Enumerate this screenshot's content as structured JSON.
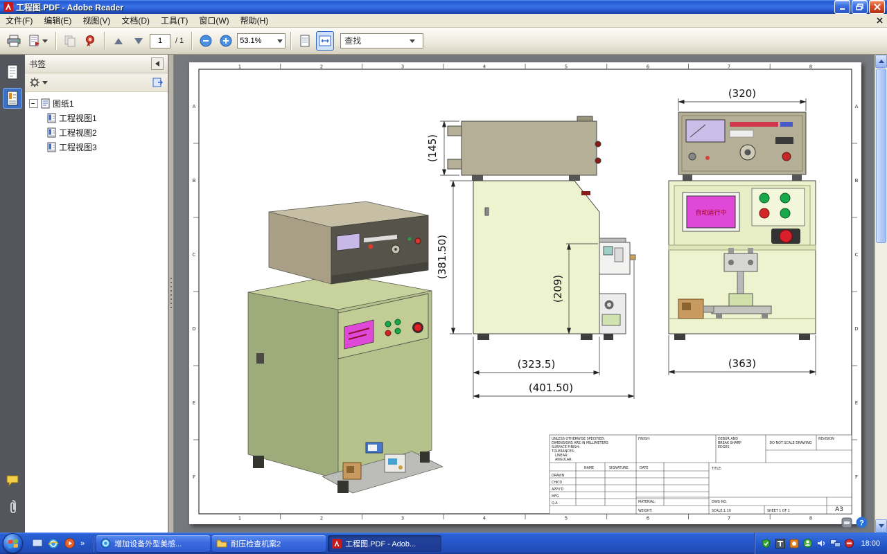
{
  "window": {
    "title": "工程图.PDF - Adobe Reader"
  },
  "menu": {
    "items": [
      "文件(F)",
      "编辑(E)",
      "视图(V)",
      "文档(D)",
      "工具(T)",
      "窗口(W)",
      "帮助(H)"
    ]
  },
  "toolbar": {
    "page_current": "1",
    "page_total": "/ 1",
    "zoom_value": "53.1%",
    "find_placeholder": "查找"
  },
  "sidebar": {
    "header": "书签",
    "tree": {
      "root": "图纸1",
      "children": [
        "工程视图1",
        "工程视图2",
        "工程视图3"
      ]
    }
  },
  "drawing": {
    "zones": {
      "cols": [
        "1",
        "2",
        "3",
        "4",
        "5",
        "6",
        "7",
        "8"
      ],
      "rows": [
        "A",
        "B",
        "C",
        "D",
        "E",
        "F"
      ]
    },
    "dims": {
      "d145": "(145)",
      "d381": "(381.50)",
      "d209": "(209)",
      "d323": "(323.5)",
      "d401": "(401.50)",
      "d320": "(320)",
      "d363": "(363)"
    },
    "screen_text": "自动运行中",
    "title_block": {
      "note1": "UNLESS OTHERWISE SPECIFIED:",
      "note2": "DIMENSIONS ARE IN MILLIMETERS",
      "note3": "SURFACE FINISH:",
      "note4": "TOLERANCES:",
      "note5": "LINEAR:",
      "note6": "ANGULAR:",
      "finish": "FINISH:",
      "debur1": "DEBUR AND",
      "debur2": "BREAK SHARP",
      "debur3": "EDGES",
      "do_not_scale": "DO NOT SCALE DRAWING",
      "revision": "REVISION",
      "name": "NAME",
      "signature": "SIGNATURE",
      "date": "DATE",
      "row1": "DRAWN",
      "row2": "CHK'D",
      "row3": "APPV'D",
      "row4": "MFG",
      "row5": "Q.A",
      "title": "TITLE:",
      "material": "MATERIAL:",
      "dwg_no": "DWG NO.",
      "weight": "WEIGHT:",
      "scale": "SCALE:1:10",
      "sheet": "SHEET 1 OF 1",
      "size": "A3"
    }
  },
  "taskbar": {
    "overflow_glyph": "»",
    "tasks": [
      {
        "label": "增加设备外型美感..."
      },
      {
        "label": "耐压检查机案2"
      },
      {
        "label": "工程图.PDF - Adob..."
      }
    ],
    "clock": "18:00"
  },
  "icons": {
    "help_glyph": "?"
  }
}
